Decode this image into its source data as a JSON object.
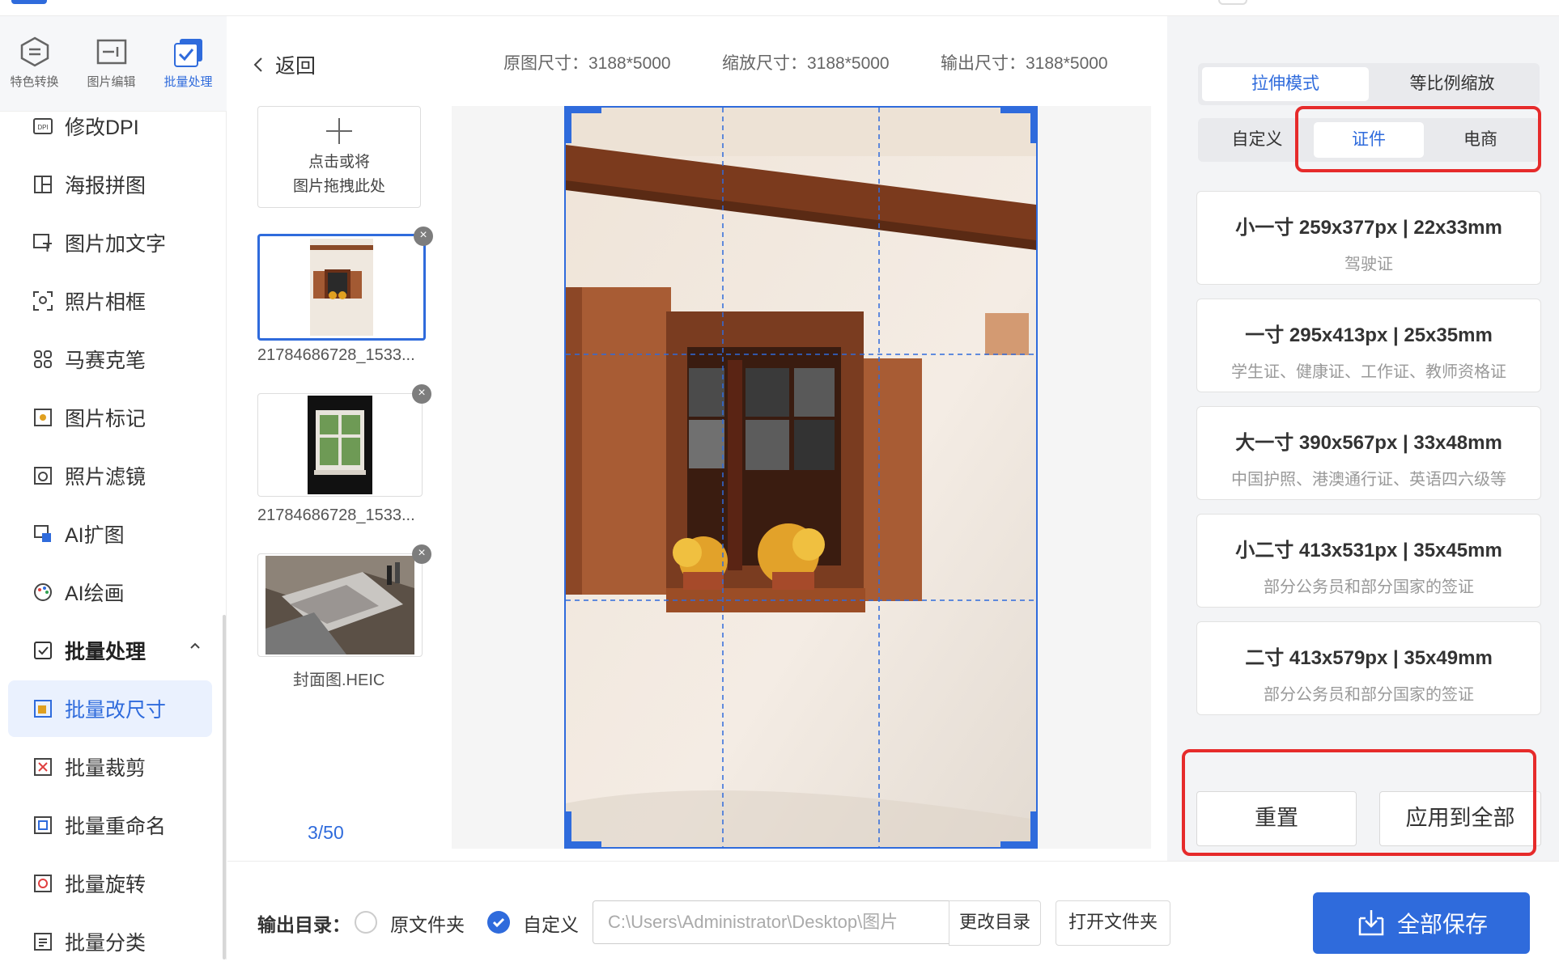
{
  "sidebar": {
    "tabs": [
      {
        "label": "特色转换",
        "icon": "transform-icon"
      },
      {
        "label": "图片编辑",
        "icon": "image-edit-icon"
      },
      {
        "label": "批量处理",
        "icon": "batch-icon"
      }
    ],
    "items": [
      {
        "label": "修改DPI",
        "icon": "dpi-icon"
      },
      {
        "label": "海报拼图",
        "icon": "collage-icon"
      },
      {
        "label": "图片加文字",
        "icon": "text-image-icon"
      },
      {
        "label": "照片相框",
        "icon": "frame-icon"
      },
      {
        "label": "马赛克笔",
        "icon": "mosaic-icon"
      },
      {
        "label": "图片标记",
        "icon": "marker-icon"
      },
      {
        "label": "照片滤镜",
        "icon": "filter-icon"
      },
      {
        "label": "AI扩图",
        "icon": "ai-expand-icon"
      },
      {
        "label": "AI绘画",
        "icon": "ai-paint-icon"
      },
      {
        "label": "批量处理",
        "icon": "batch-group-icon"
      },
      {
        "label": "批量改尺寸",
        "icon": "resize-icon"
      },
      {
        "label": "批量裁剪",
        "icon": "crop-icon"
      },
      {
        "label": "批量重命名",
        "icon": "rename-icon"
      },
      {
        "label": "批量旋转",
        "icon": "rotate-icon"
      },
      {
        "label": "批量分类",
        "icon": "classify-icon"
      }
    ]
  },
  "header": {
    "back_label": "返回",
    "original_size": "原图尺寸：3188*5000",
    "scaled_size": "缩放尺寸：3188*5000",
    "output_size": "输出尺寸：3188*5000"
  },
  "upload": {
    "line1": "点击或将",
    "line2": "图片拖拽此处"
  },
  "thumbnails": [
    {
      "name": "21784686728_1533..."
    },
    {
      "name": "21784686728_1533..."
    },
    {
      "name": "封面图.HEIC"
    }
  ],
  "counter": "3/50",
  "right": {
    "mode_tabs": [
      "拉伸模式",
      "等比例缩放"
    ],
    "sub_tabs": [
      "自定义",
      "证件",
      "电商"
    ],
    "sizes": [
      {
        "title": "小一寸 259x377px | 22x33mm",
        "sub": "驾驶证"
      },
      {
        "title": "一寸 295x413px | 25x35mm",
        "sub": "学生证、健康证、工作证、教师资格证"
      },
      {
        "title": "大一寸 390x567px | 33x48mm",
        "sub": "中国护照、港澳通行证、英语四六级等"
      },
      {
        "title": "小二寸 413x531px | 35x45mm",
        "sub": "部分公务员和部分国家的签证"
      },
      {
        "title": "二寸 413x579px | 35x49mm",
        "sub": "部分公务员和部分国家的签证"
      }
    ],
    "reset_label": "重置",
    "apply_label": "应用到全部"
  },
  "bottom": {
    "output_label": "输出目录：",
    "radio_original": "原文件夹",
    "radio_custom": "自定义",
    "path_value": "C:\\Users\\Administrator\\Desktop\\图片",
    "change_dir_label": "更改目录",
    "open_folder_label": "打开文件夹",
    "save_all_label": "全部保存"
  },
  "colors": {
    "accent": "#2f6bdc",
    "highlight": "#e62b2b"
  }
}
